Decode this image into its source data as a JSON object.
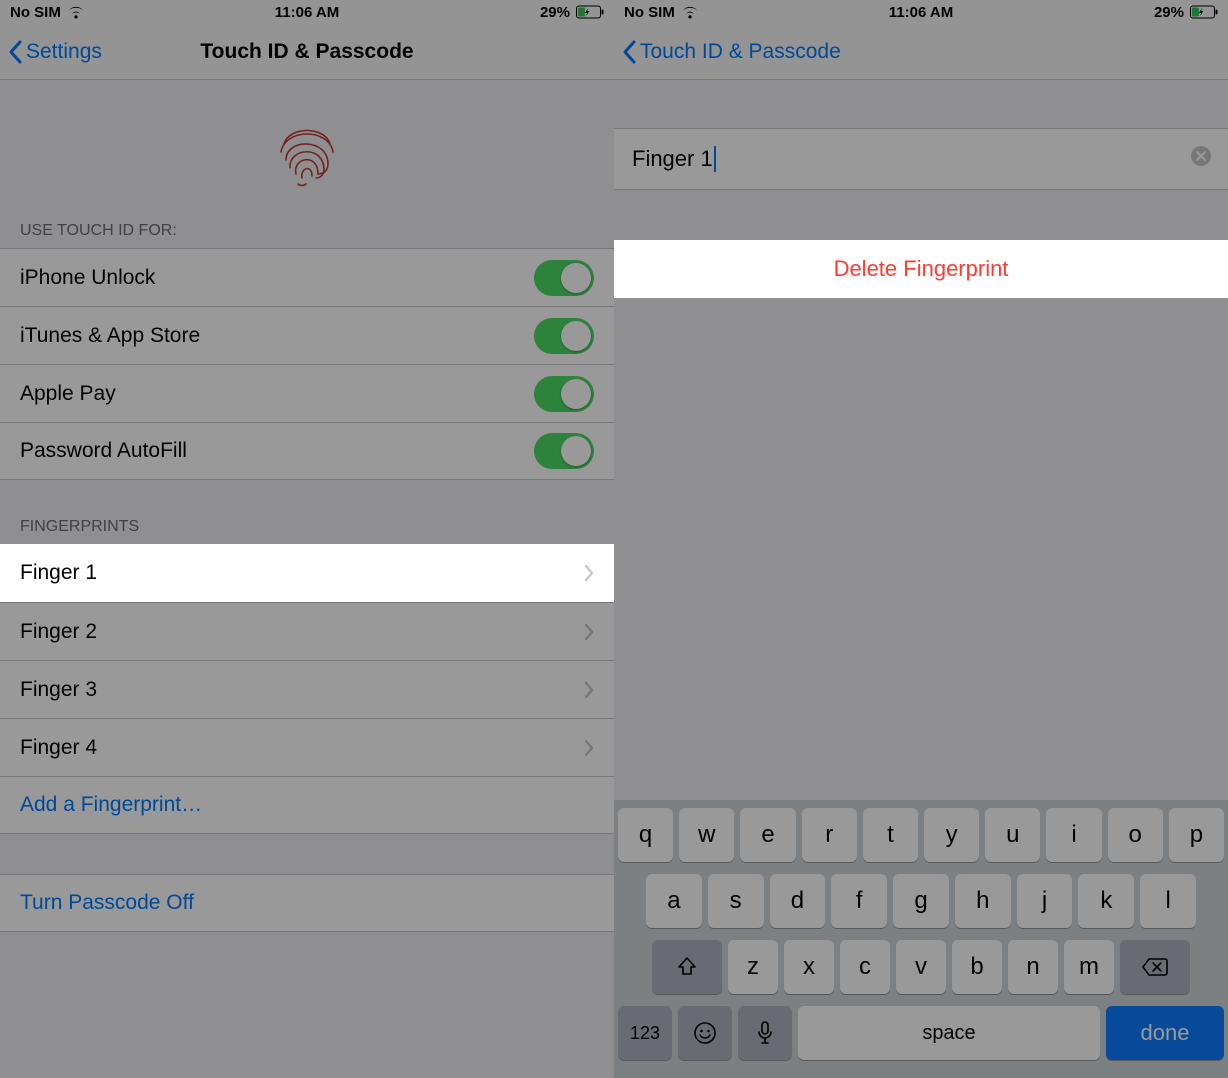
{
  "status": {
    "carrier": "No SIM",
    "time": "11:06 AM",
    "battery_pct": "29%"
  },
  "left": {
    "back_label": "Settings",
    "title": "Touch ID & Passcode",
    "section_use": "USE TOUCH ID FOR:",
    "toggles": {
      "unlock": "iPhone Unlock",
      "itunes": "iTunes & App Store",
      "applepay": "Apple Pay",
      "autofill": "Password AutoFill"
    },
    "section_fp": "FINGERPRINTS",
    "fingers": {
      "f1": "Finger 1",
      "f2": "Finger 2",
      "f3": "Finger 3",
      "f4": "Finger 4"
    },
    "add_fp": "Add a Fingerprint…",
    "turn_off": "Turn Passcode Off"
  },
  "right": {
    "back_label": "Touch ID & Passcode",
    "field_value": "Finger 1",
    "delete_label": "Delete Fingerprint"
  },
  "keyboard": {
    "row1": {
      "k0": "q",
      "k1": "w",
      "k2": "e",
      "k3": "r",
      "k4": "t",
      "k5": "y",
      "k6": "u",
      "k7": "i",
      "k8": "o",
      "k9": "p"
    },
    "row2": {
      "k0": "a",
      "k1": "s",
      "k2": "d",
      "k3": "f",
      "k4": "g",
      "k5": "h",
      "k6": "j",
      "k7": "k",
      "k8": "l"
    },
    "row3": {
      "k0": "z",
      "k1": "x",
      "k2": "c",
      "k3": "v",
      "k4": "b",
      "k5": "n",
      "k6": "m"
    },
    "numkey": "123",
    "space": "space",
    "done": "done"
  }
}
